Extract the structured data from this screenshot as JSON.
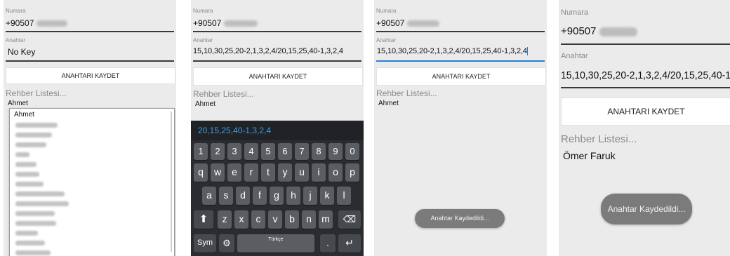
{
  "panel1": {
    "numara_label": "Numara",
    "numara_value": "+90507",
    "anahtar_label": "Anahtar",
    "anahtar_value": "No Key",
    "save_button": "ANAHTARI KAYDET",
    "rehber_label": "Rehber Listesi...",
    "spinner_value": "Ahmet",
    "dropdown_first": "Ahmet"
  },
  "panel2": {
    "numara_label": "Numara",
    "numara_value": "+90507",
    "anahtar_label": "Anahtar",
    "anahtar_value": "15,10,30,25,20-2,1,3,2,4/20,15,25,40-1,3,2,4",
    "save_button": "ANAHTARI KAYDET",
    "rehber_label": "Rehber Listesi...",
    "spinner_value": "Ahmet",
    "keyboard": {
      "suggestion": "20,15,25,40-1,3,2,4",
      "numbers": [
        "1",
        "2",
        "3",
        "4",
        "5",
        "6",
        "7",
        "8",
        "9",
        "0"
      ],
      "row1": [
        "q",
        "w",
        "e",
        "r",
        "t",
        "y",
        "u",
        "i",
        "o",
        "p"
      ],
      "row2": [
        "a",
        "s",
        "d",
        "f",
        "g",
        "h",
        "j",
        "k",
        "l"
      ],
      "row3": [
        "z",
        "x",
        "c",
        "v",
        "b",
        "n",
        "m"
      ],
      "sym_label": "Sym",
      "space_label": "Türkçe",
      "shift_icon": "shift-arrow-icon",
      "backspace_icon": "backspace-icon",
      "enter_icon": "enter-arrow-icon",
      "settings_icon": "gear-icon"
    }
  },
  "panel3": {
    "numara_label": "Numara",
    "numara_value": "+90507",
    "anahtar_label": "Anahtar",
    "anahtar_value": "15,10,30,25,20-2,1,3,2,4/20,15,25,40-1,3,2,4",
    "save_button": "ANAHTARI KAYDET",
    "rehber_label": "Rehber Listesi...",
    "spinner_value": "Ahmet",
    "toast": "Anahtar Kaydedildi..."
  },
  "panel4": {
    "numara_label": "Numara",
    "numara_value": "+90507",
    "anahtar_label": "Anahtar",
    "anahtar_value": "15,10,30,25,20-2,1,3,2,4/20,15,25,40-1,3,2,4",
    "save_button": "ANAHTARI KAYDET",
    "rehber_label": "Rehber Listesi...",
    "spinner_value": "Ömer Faruk",
    "toast": "Anahtar Kaydedildi..."
  }
}
